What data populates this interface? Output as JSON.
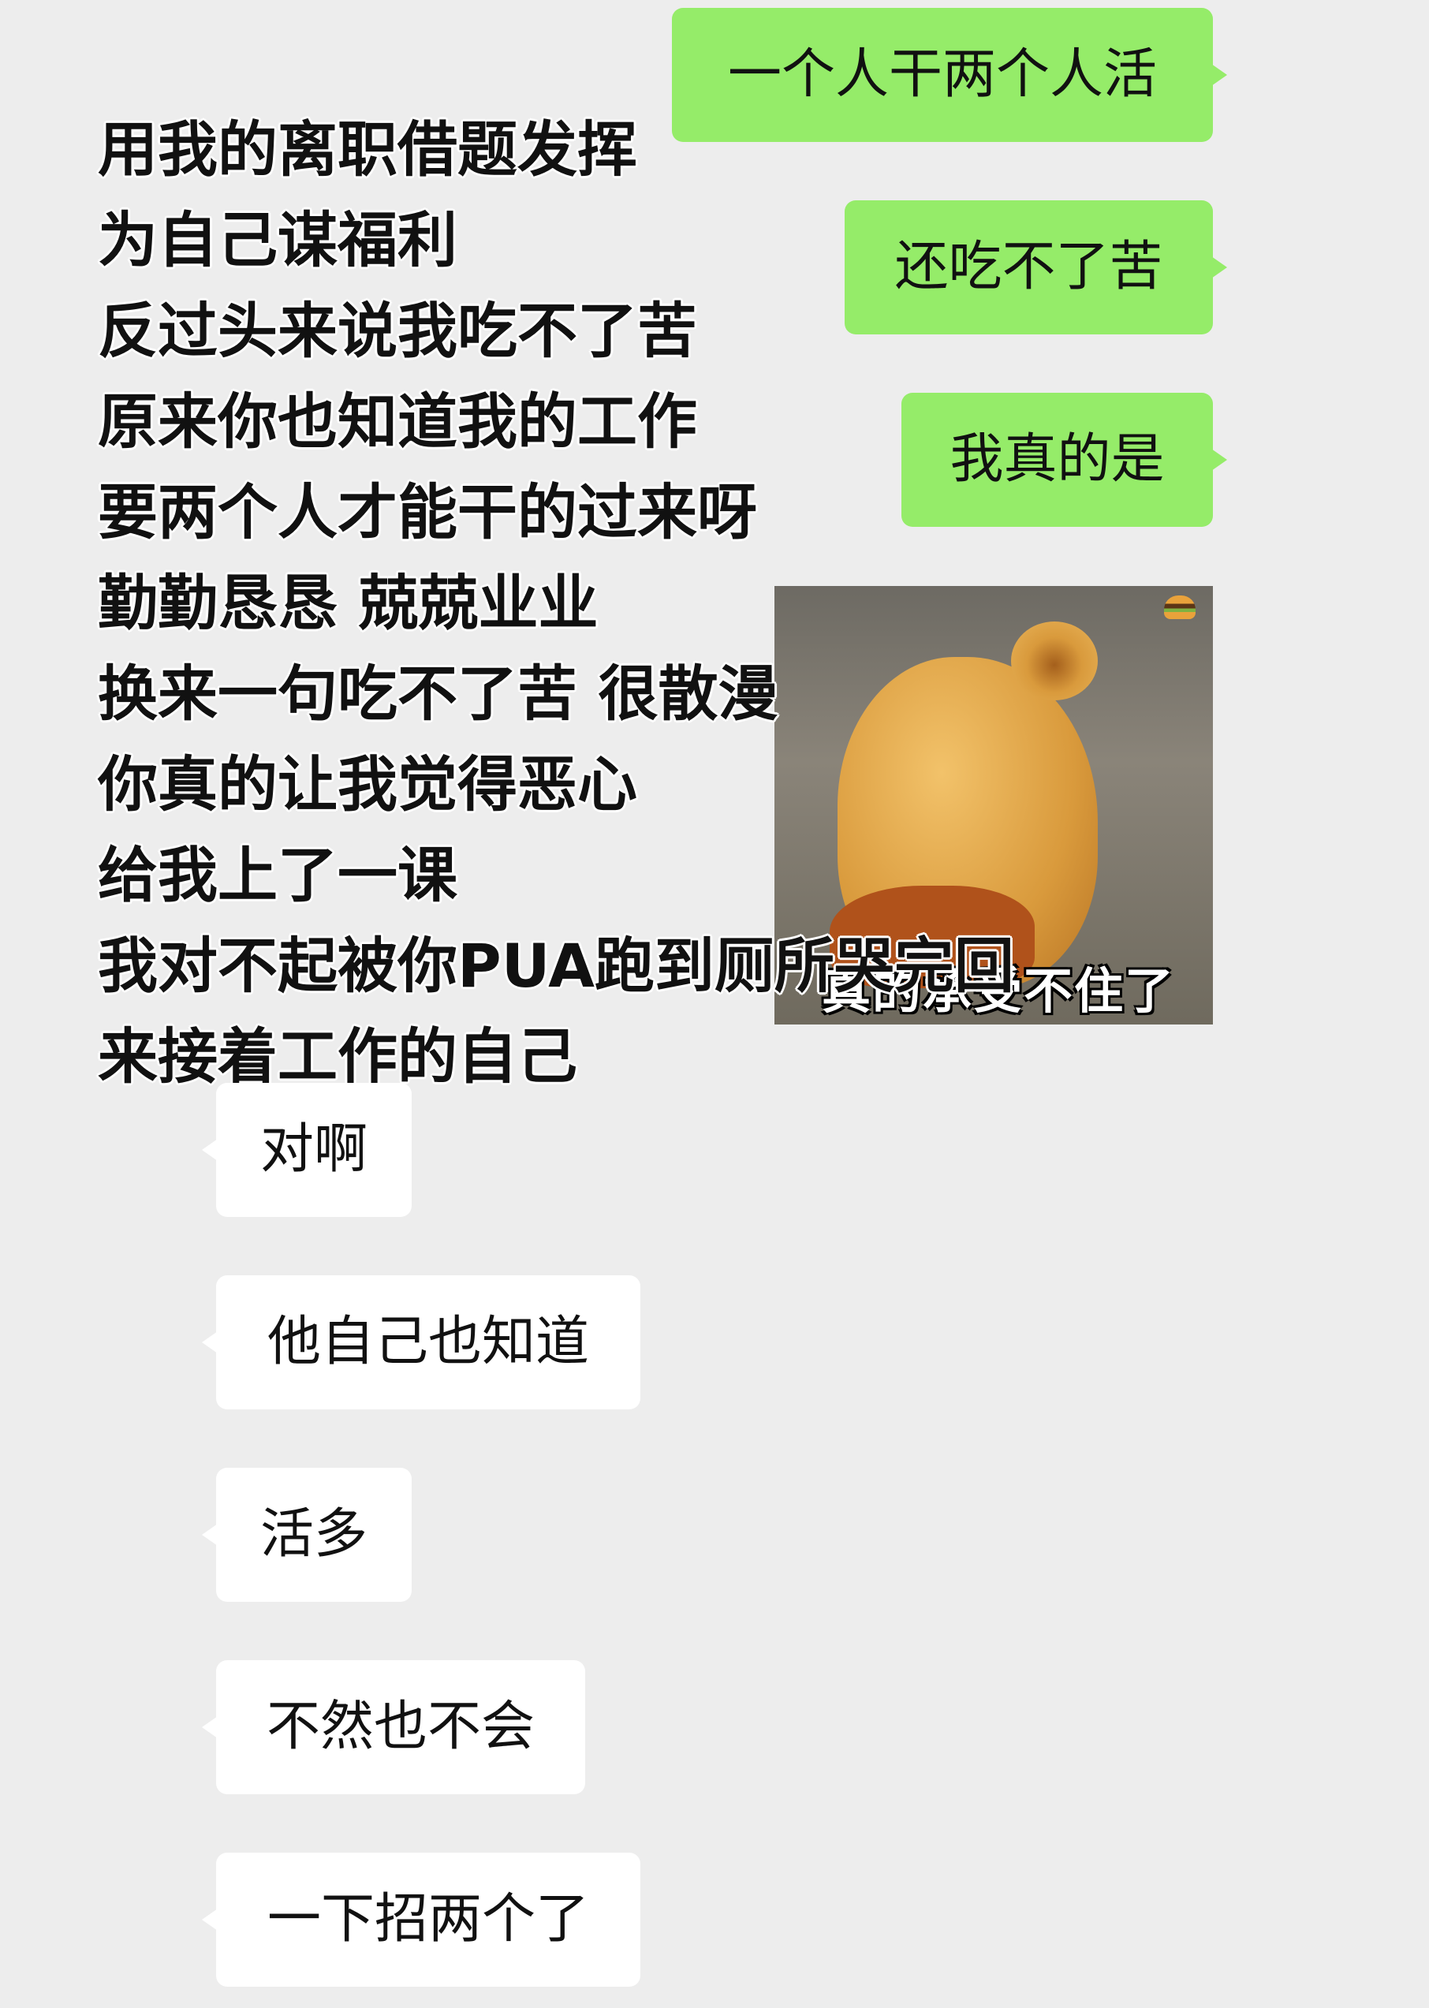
{
  "colors": {
    "outgoing_bubble": "#95ec69",
    "incoming_bubble": "#ffffff",
    "background": "#ededed"
  },
  "outgoing_messages": [
    "一个人干两个人活",
    "还吃不了苦",
    "我真的是"
  ],
  "sticker": {
    "caption": "真的承受不住了",
    "icon": "burger-icon"
  },
  "overlay_lines": [
    "用我的离职借题发挥",
    "为自己谋福利",
    "反过头来说我吃不了苦",
    "原来你也知道我的工作",
    "要两个人才能干的过来呀",
    "勤勤恳恳 兢兢业业",
    "换来一句吃不了苦 很散漫",
    "你真的让我觉得恶心",
    "给我上了一课",
    "我对不起被你PUA跑到厕所哭完回",
    "来接着工作的自己"
  ],
  "incoming_messages": [
    "对啊",
    "他自己也知道",
    "活多",
    "不然也不会",
    "一下招两个了"
  ]
}
